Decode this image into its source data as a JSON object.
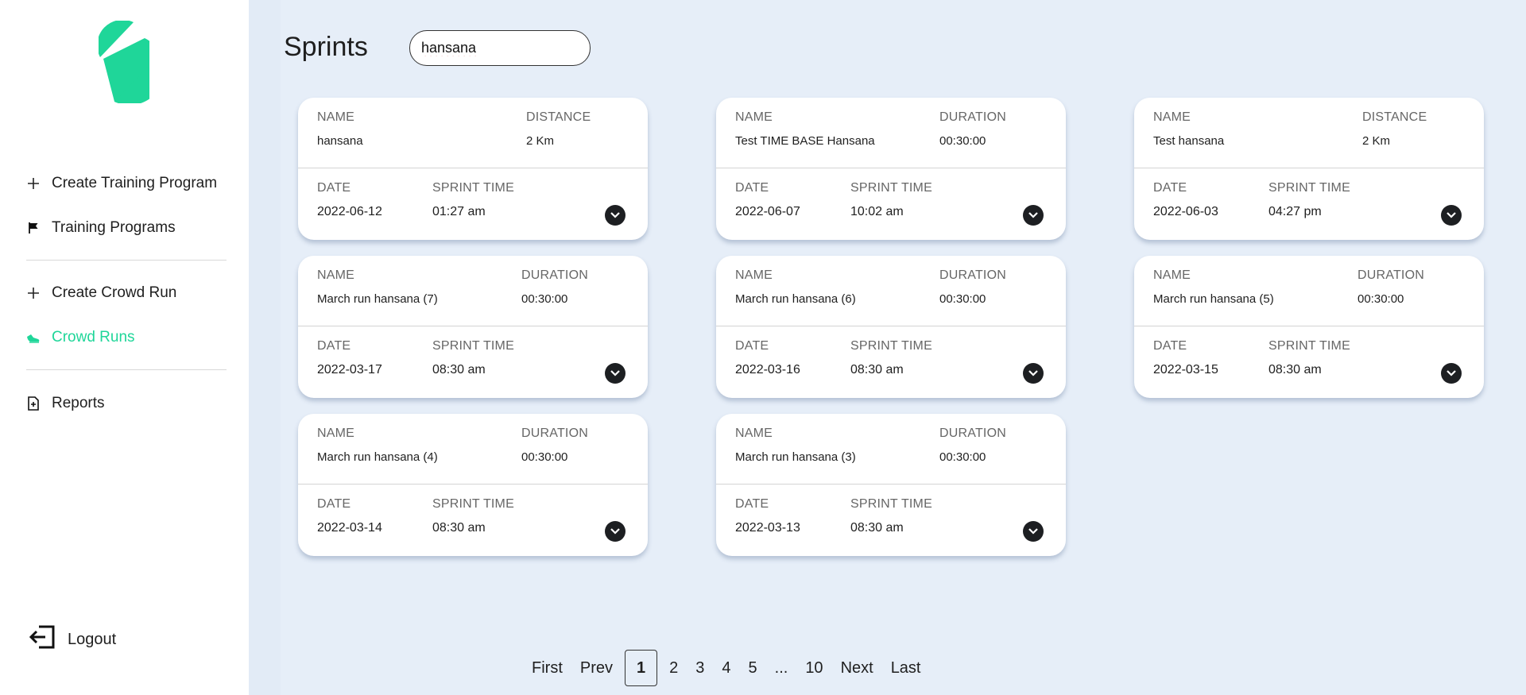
{
  "app": {
    "brand_color": "#1fd699",
    "icon": "stride-logo-icon"
  },
  "sidebar": {
    "items": [
      {
        "label": "Create Training Program",
        "icon": "plus-icon"
      },
      {
        "label": "Training Programs",
        "icon": "flag-icon"
      },
      {
        "label": "Create Crowd Run",
        "icon": "plus-icon"
      },
      {
        "label": "Crowd Runs",
        "icon": "running-shoe-icon",
        "active": true
      },
      {
        "label": "Reports",
        "icon": "report-icon"
      }
    ],
    "logout_label": "Logout"
  },
  "header": {
    "title": "Sprints"
  },
  "search": {
    "value": "hansana",
    "placeholder": ""
  },
  "cards": [
    {
      "name_label": "NAME",
      "name": "hansana",
      "metric_label": "DISTANCE",
      "metric": "2 Km",
      "date_label": "DATE",
      "date": "2022-06-12",
      "time_label": "SPRINT TIME",
      "time": "01:27 am"
    },
    {
      "name_label": "NAME",
      "name": "Test TIME BASE Hansana",
      "metric_label": "DURATION",
      "metric": "00:30:00",
      "date_label": "DATE",
      "date": "2022-06-07",
      "time_label": "SPRINT TIME",
      "time": "10:02 am"
    },
    {
      "name_label": "NAME",
      "name": "Test hansana",
      "metric_label": "DISTANCE",
      "metric": "2 Km",
      "date_label": "DATE",
      "date": "2022-06-03",
      "time_label": "SPRINT TIME",
      "time": "04:27 pm"
    },
    {
      "name_label": "NAME",
      "name": "March run hansana (7)",
      "metric_label": "DURATION",
      "metric": "00:30:00",
      "date_label": "DATE",
      "date": "2022-03-17",
      "time_label": "SPRINT TIME",
      "time": "08:30 am"
    },
    {
      "name_label": "NAME",
      "name": "March run hansana (6)",
      "metric_label": "DURATION",
      "metric": "00:30:00",
      "date_label": "DATE",
      "date": "2022-03-16",
      "time_label": "SPRINT TIME",
      "time": "08:30 am"
    },
    {
      "name_label": "NAME",
      "name": "March run hansana (5)",
      "metric_label": "DURATION",
      "metric": "00:30:00",
      "date_label": "DATE",
      "date": "2022-03-15",
      "time_label": "SPRINT TIME",
      "time": "08:30 am"
    },
    {
      "name_label": "NAME",
      "name": "March run hansana (4)",
      "metric_label": "DURATION",
      "metric": "00:30:00",
      "date_label": "DATE",
      "date": "2022-03-14",
      "time_label": "SPRINT TIME",
      "time": "08:30 am"
    },
    {
      "name_label": "NAME",
      "name": "March run hansana (3)",
      "metric_label": "DURATION",
      "metric": "00:30:00",
      "date_label": "DATE",
      "date": "2022-03-13",
      "time_label": "SPRINT TIME",
      "time": "08:30 am"
    }
  ],
  "pagination": {
    "first": "First",
    "prev": "Prev",
    "pages": [
      "1",
      "2",
      "3",
      "4",
      "5",
      "...",
      "10"
    ],
    "current": "1",
    "next": "Next",
    "last": "Last"
  }
}
